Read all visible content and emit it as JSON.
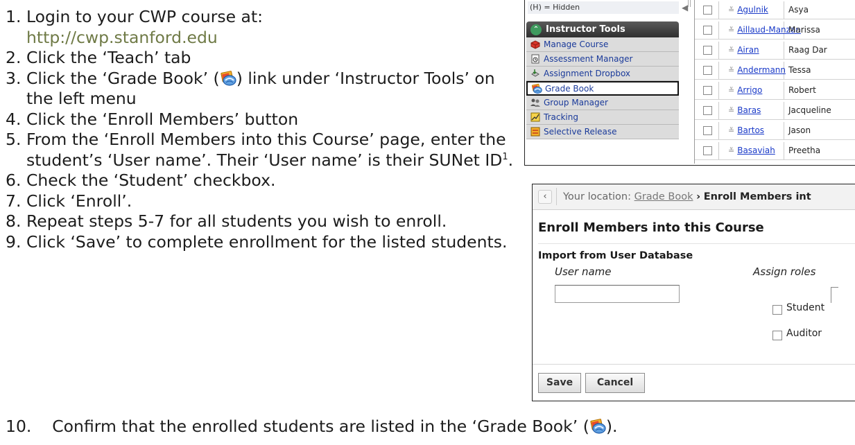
{
  "instructions": {
    "steps": [
      {
        "num": "1.",
        "text": "Login to your CWP course at:",
        "url": "http://cwp.stanford.edu"
      },
      {
        "num": "2.",
        "text": "Click the ‘Teach’ tab"
      },
      {
        "num": "3.",
        "text_a": "Click the ‘Grade Book’ (",
        "text_b": ") link under ‘Instructor Tools’ on the left menu"
      },
      {
        "num": "4.",
        "text": "Click the ‘Enroll Members’ button"
      },
      {
        "num": "5.",
        "text_a": "From the ‘Enroll Members into this Course’ page, enter the student’s ‘User name’. Their ‘User name’ is their SUNet ID",
        "sup": "1",
        "text_b": "."
      },
      {
        "num": "6.",
        "text": "Check the ‘Student’ checkbox."
      },
      {
        "num": "7.",
        "text": "Click ‘Enroll’."
      },
      {
        "num": "8.",
        "text": "Repeat steps 5-7 for all students you wish to enroll."
      },
      {
        "num": "9.",
        "text": "Click ‘Save’ to complete enrollment for the listed students."
      }
    ],
    "step10": {
      "num": "10.",
      "text_a": "Confirm that the enrolled students are listed in the ‘Grade Book’ (",
      "text_b": ")."
    }
  },
  "sidebar": {
    "hidden_legend": "(H) = Hidden",
    "header": "Instructor Tools",
    "tools": [
      {
        "label": "Manage Course",
        "icon": "manage-course-icon"
      },
      {
        "label": "Assessment Manager",
        "icon": "assessment-manager-icon"
      },
      {
        "label": "Assignment Dropbox",
        "icon": "assignment-dropbox-icon"
      },
      {
        "label": "Grade Book",
        "icon": "grade-book-icon",
        "active": true
      },
      {
        "label": "Group Manager",
        "icon": "group-manager-icon"
      },
      {
        "label": "Tracking",
        "icon": "tracking-icon"
      },
      {
        "label": "Selective Release",
        "icon": "selective-release-icon"
      }
    ]
  },
  "roster": {
    "rows": [
      {
        "last": "Agulnik",
        "first": "Asya"
      },
      {
        "last": "Aillaud-Manzan",
        "first": "Marissa"
      },
      {
        "last": "Airan",
        "first": "Raag Dar"
      },
      {
        "last": "Andermann",
        "first": "Tessa"
      },
      {
        "last": "Arrigo",
        "first": "Robert"
      },
      {
        "last": "Baras",
        "first": "Jacqueline"
      },
      {
        "last": "Bartos",
        "first": "Jason"
      },
      {
        "last": "Basaviah",
        "first": "Preetha"
      }
    ]
  },
  "enroll": {
    "location_prefix": "Your location:",
    "location_link": "Grade Book",
    "location_sep": "›",
    "location_current": "Enroll Members int",
    "page_title": "Enroll Members into this Course",
    "section_title": "Import from User Database",
    "col_username": "User name",
    "col_roles": "Assign roles",
    "role_student": "Student",
    "role_auditor": "Auditor",
    "username_value": "",
    "save_label": "Save",
    "cancel_label": "Cancel"
  },
  "colors": {
    "url": "#6f7a46",
    "link": "#1a3ac8",
    "active_border": "#111111"
  }
}
